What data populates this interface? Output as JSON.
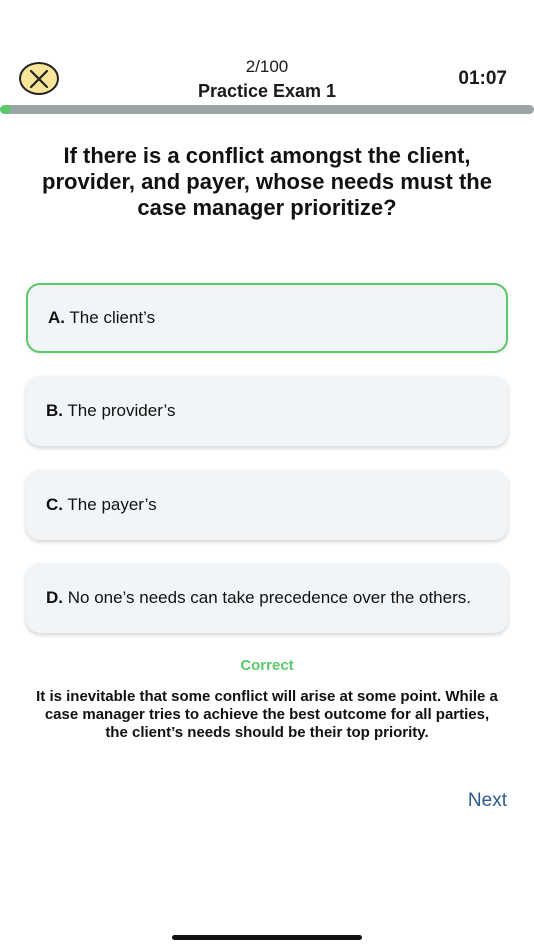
{
  "header": {
    "counter": "2/100",
    "exam_title": "Practice Exam 1",
    "timer": "01:07",
    "close_icon": "close-x-icon",
    "progress_fraction": 0.02
  },
  "question": {
    "text": "If there is a conflict amongst the client, provider, and payer, whose needs must the case manager prioritize?"
  },
  "options": [
    {
      "letter": "A.",
      "text": "The client’s",
      "state": "correct-selected"
    },
    {
      "letter": "B.",
      "text": "The provider’s"
    },
    {
      "letter": "C.",
      "text": "The payer’s"
    },
    {
      "letter": "D.",
      "text": "No one’s needs can take precedence over the others."
    }
  ],
  "feedback": {
    "result": "Correct",
    "explanation": "It is inevitable that some conflict will arise at some point. While a case manager tries to achieve the best outcome for all parties, the client’s needs should be their top priority."
  },
  "navigation": {
    "next_label": "Next"
  },
  "colors": {
    "correct": "#5cc86a",
    "close_button": "#fbe59a",
    "progress_track": "#9aa5a8",
    "link": "#2f5a8f",
    "option_bg": "#f2f5f7"
  }
}
